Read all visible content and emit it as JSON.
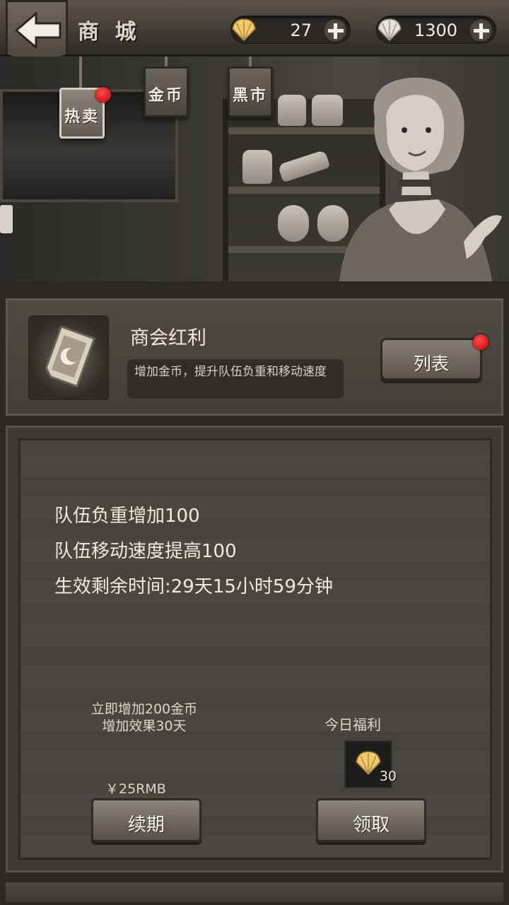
{
  "header": {
    "title": "商 城",
    "currencies": [
      {
        "icon": "shell-icon",
        "amount": "27"
      },
      {
        "icon": "shell-icon",
        "amount": "1300"
      }
    ]
  },
  "tabs": [
    {
      "label": "热卖",
      "active": true,
      "badge": true
    },
    {
      "label": "金币",
      "active": false,
      "badge": false
    },
    {
      "label": "黑市",
      "active": false,
      "badge": false
    }
  ],
  "bonus": {
    "title": "商会红利",
    "description": "增加金币，提升队伍负重和移动速度",
    "list_button": "列表"
  },
  "details": {
    "lines": [
      "队伍负重增加100",
      "队伍移动速度提高100",
      "生效剩余时间:29天15小时59分钟"
    ],
    "offer_line1": "立即增加200金币",
    "offer_line2": "增加效果30天",
    "price": "￥25RMB",
    "renew_button": "续期",
    "daily_title": "今日福利",
    "daily_amount": "30",
    "claim_button": "领取"
  },
  "colors": {
    "badge": "#e00000",
    "shell": "#f3c96b"
  }
}
